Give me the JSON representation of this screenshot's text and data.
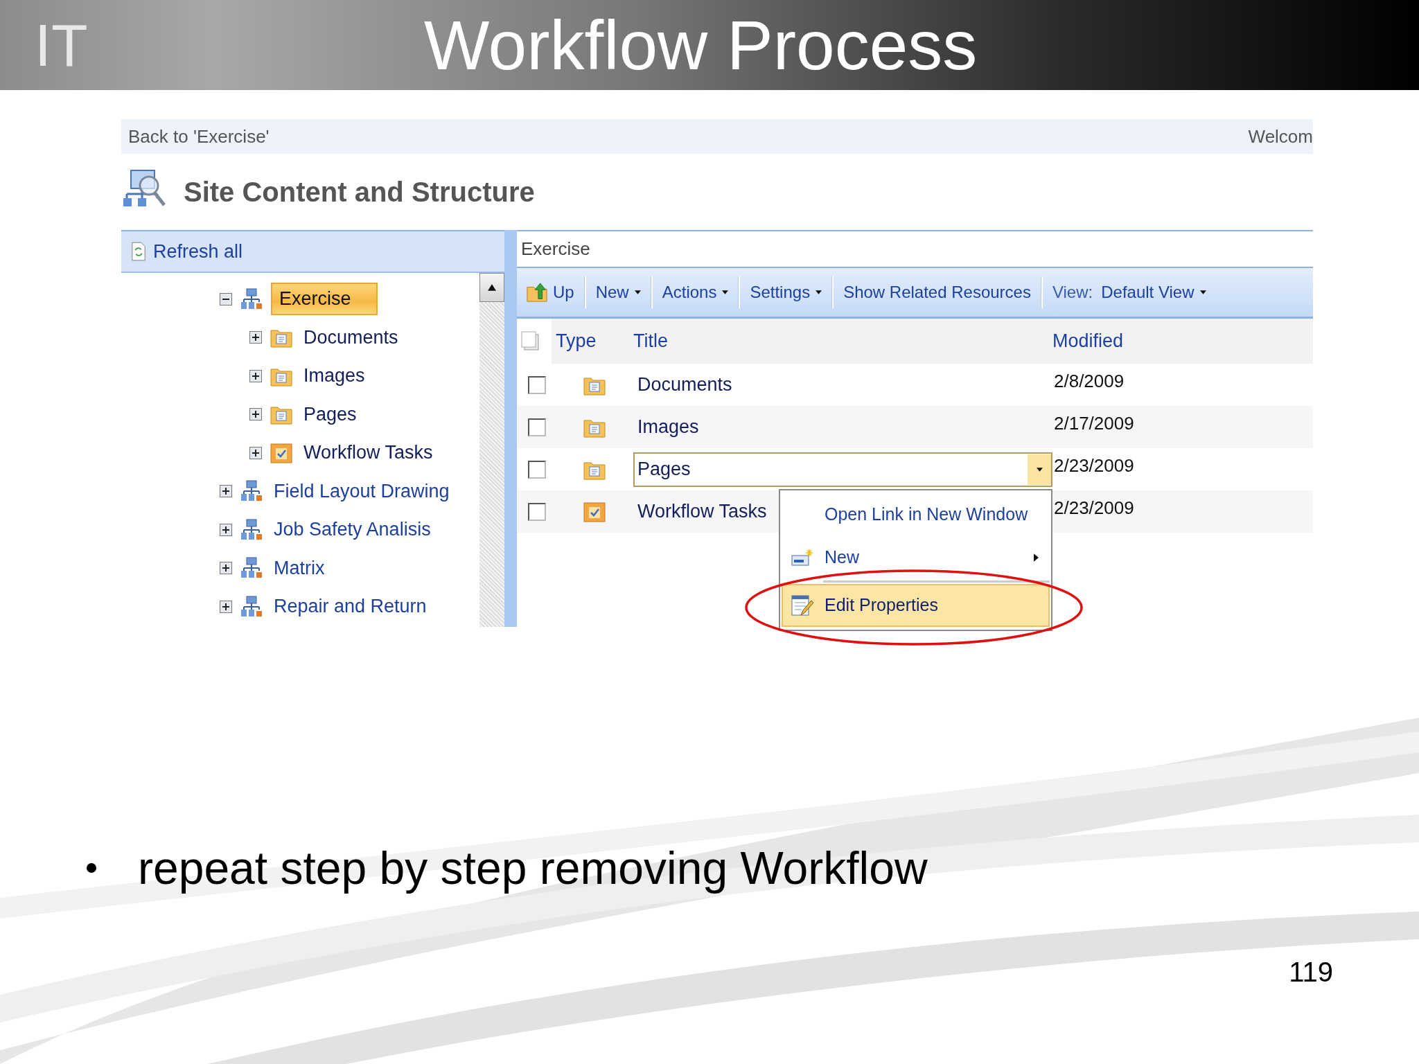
{
  "slide": {
    "logo": "IT",
    "title": "Workflow Process",
    "bullets": [
      "repeat step by step removing Workflow"
    ],
    "page_number": "119"
  },
  "screenshot": {
    "top_bar": {
      "back_link": "Back to 'Exercise'",
      "welcome": "Welcom"
    },
    "page_title": "Site Content and Structure",
    "tree_panel": {
      "refresh": "Refresh all",
      "tree": [
        {
          "label": "Exercise",
          "kind": "site",
          "expanded": true,
          "selected": true,
          "children": [
            {
              "label": "Documents",
              "kind": "library",
              "expanded": false,
              "selected": false
            },
            {
              "label": "Images",
              "kind": "library",
              "expanded": false,
              "selected": false
            },
            {
              "label": "Pages",
              "kind": "library",
              "expanded": false,
              "selected": false
            },
            {
              "label": "Workflow Tasks",
              "kind": "tasks",
              "expanded": false,
              "selected": false
            }
          ]
        },
        {
          "label": "Field Layout Drawing",
          "kind": "site",
          "expanded": false,
          "selected": false
        },
        {
          "label": "Job Safety Analisis",
          "kind": "site",
          "expanded": false,
          "selected": false
        },
        {
          "label": "Matrix",
          "kind": "site",
          "expanded": false,
          "selected": false
        },
        {
          "label": "Repair and Return",
          "kind": "site",
          "expanded": false,
          "selected": false
        }
      ]
    },
    "list_panel": {
      "breadcrumb": "Exercise",
      "toolbar": [
        {
          "label": "Up",
          "kind": "up"
        },
        {
          "label": "New",
          "kind": "menu"
        },
        {
          "label": "Actions",
          "kind": "menu"
        },
        {
          "label": "Settings",
          "kind": "menu"
        },
        {
          "label": "Show Related Resources",
          "kind": "button"
        }
      ],
      "view": {
        "label": "View:",
        "value": "Default View"
      },
      "columns": [
        "Type",
        "Title",
        "Modified"
      ],
      "rows": [
        {
          "kind": "library",
          "title": "Documents",
          "modified": "2/8/2009",
          "checked": false,
          "selected": false
        },
        {
          "kind": "library",
          "title": "Images",
          "modified": "2/17/2009",
          "checked": false,
          "selected": false
        },
        {
          "kind": "library",
          "title": "Pages",
          "modified": "2/23/2009",
          "checked": false,
          "selected": true
        },
        {
          "kind": "tasks",
          "title": "Workflow Tasks",
          "modified": "2/23/2009",
          "checked": false,
          "selected": false
        }
      ],
      "context_menu": [
        {
          "label": "Open Link in New Window",
          "kind": "link",
          "selected": false
        },
        {
          "label": "New",
          "kind": "submenu",
          "selected": false
        },
        {
          "label": "Edit Properties",
          "kind": "edit",
          "selected": true
        }
      ]
    }
  }
}
